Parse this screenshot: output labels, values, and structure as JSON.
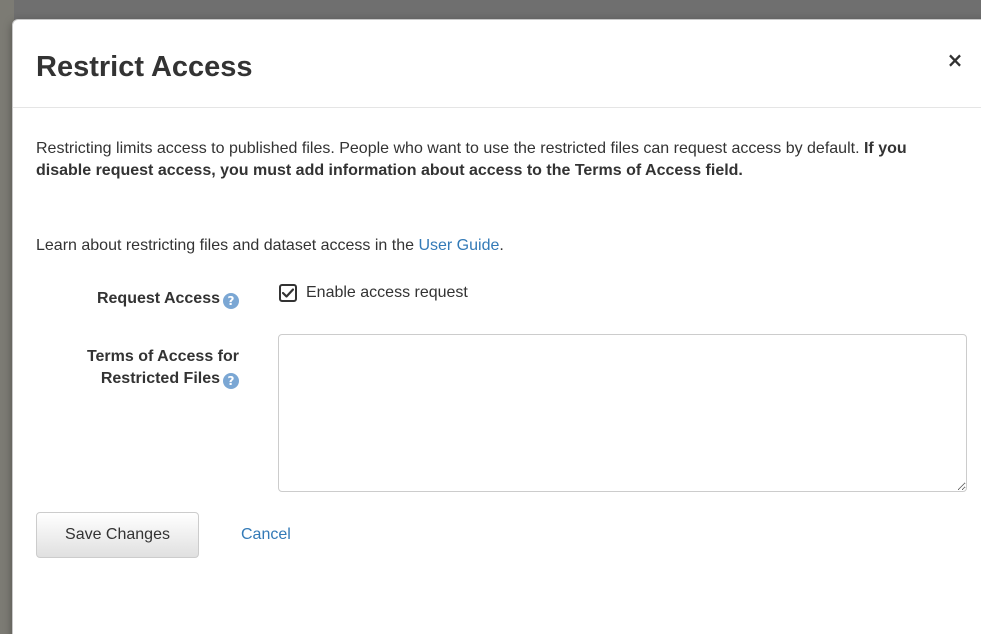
{
  "dialog": {
    "title": "Restrict Access",
    "close_symbol": "×",
    "intro_plain": "Restricting limits access to published files. People who want to use the restricted files can request access by default. ",
    "intro_bold": "If you disable request access, you must add information about access to the Terms of Access field.",
    "guide_prefix": "Learn about restricting files and dataset access in the ",
    "guide_link": "User Guide",
    "guide_suffix": ".",
    "request_access": {
      "label": "Request Access",
      "help_icon": "question-circle-icon",
      "checkbox_label": "Enable access request",
      "checked": true
    },
    "terms": {
      "label_line1": "Terms of Access for",
      "label_line2": "Restricted Files",
      "help_icon": "question-circle-icon",
      "value": ""
    },
    "save_label": "Save Changes",
    "cancel_label": "Cancel"
  },
  "colors": {
    "link": "#337ab7",
    "help_icon": "#7ba7d4",
    "text": "#333333"
  }
}
